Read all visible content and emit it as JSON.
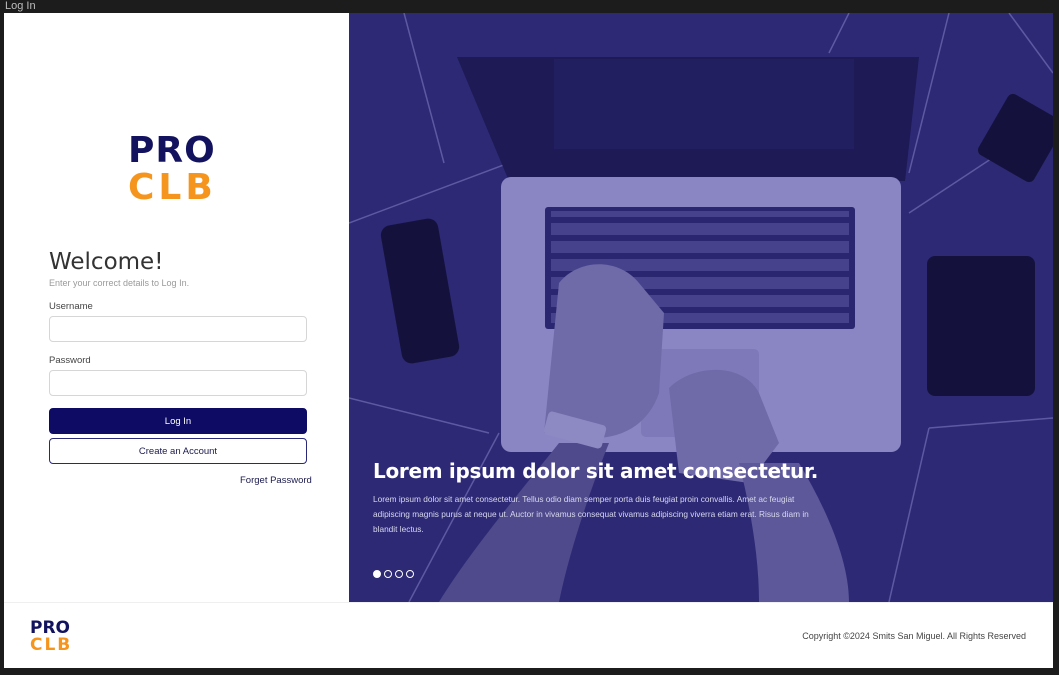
{
  "window": {
    "title": "Log In"
  },
  "brand": {
    "line1": "PRO",
    "line2": "CLB",
    "primary_color": "#12125e",
    "accent_color": "#f5951d"
  },
  "login": {
    "heading": "Welcome!",
    "subtext": "Enter your correct details to Log In.",
    "username_label": "Username",
    "username_value": "",
    "password_label": "Password",
    "password_value": "",
    "login_button": "Log In",
    "create_button": "Create an Account",
    "forgot_link": "Forget Password"
  },
  "hero": {
    "title": "Lorem ipsum dolor sit amet consectetur.",
    "body": "Lorem ipsum dolor sit amet consectetur. Tellus odio diam semper porta duis feugiat proin convallis. Amet ac feugiat adipiscing magnis purus at neque ut. Auctor in vivamus consequat vivamus adipiscing viverra etiam erat. Risus diam in blandit lectus.",
    "overlay_color": "#2b2770",
    "slides": 4,
    "active_slide": 1
  },
  "footer": {
    "copyright": "Copyright ©2024 Smits San Miguel. All Rights Reserved"
  }
}
